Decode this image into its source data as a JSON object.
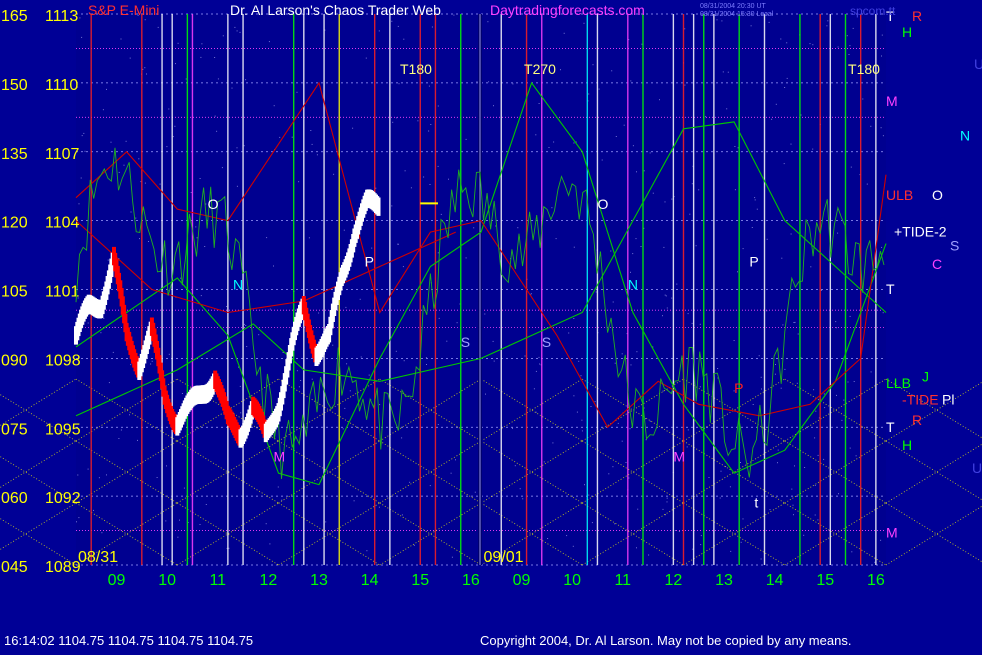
{
  "header": {
    "symbol": "S&P E-Mini",
    "site_title": "Dr. Al Larson's Chaos Trader Web",
    "site_url": "Daytradingforecasts.com",
    "stamp_line1": "08/31/2004 20:30 UT",
    "stamp_line2": "08/31/2004 15:30 Local",
    "brand": "spcom.tt"
  },
  "footer": {
    "quote": "16:14:02  1104.75 1104.75 1104.75 1104.75",
    "copyright": "Copyright 2004, Dr. Al Larson. May not be copied by any means."
  },
  "chart_data": {
    "type": "line",
    "price_ticks": [
      "1113",
      "1110",
      "1107",
      "1104",
      "1101",
      "1098",
      "1095",
      "1092",
      "1089"
    ],
    "angle_ticks": [
      "165",
      "150",
      "135",
      "120",
      "105",
      "090",
      "075",
      "060",
      "045"
    ],
    "ylim": [
      1089,
      1113
    ],
    "x_hours": [
      "09",
      "10",
      "11",
      "12",
      "13",
      "14",
      "15",
      "16",
      "09",
      "10",
      "11",
      "12",
      "13",
      "14",
      "15",
      "16"
    ],
    "dates": [
      "08/31",
      "09/01"
    ],
    "time_markers": [
      "T180",
      "T270",
      "T180"
    ],
    "tide_labels": [
      "+TIDE-2",
      "-TIDE"
    ],
    "chart_labels": [
      "O",
      "P",
      "N",
      "S",
      "M",
      "O",
      "N",
      "P",
      "S",
      "M",
      "t",
      "P",
      "ULB",
      "LLB"
    ],
    "right_letters": [
      "T",
      "H",
      "M",
      "T",
      "T",
      "H",
      "M",
      "R",
      "U",
      "N",
      "O",
      "S",
      "C",
      "J",
      "Pl",
      "R",
      "U"
    ],
    "colors": {
      "background": "#000096",
      "up_bar": "#ffffff",
      "down_bar": "#ff0000",
      "flux_green": "#00c800",
      "flux_red": "#d00000",
      "grid_yellow": "#ffff00"
    },
    "series": [
      {
        "name": "S&P E-Mini",
        "x": [
          0.0,
          0.25,
          0.5,
          0.75,
          1.0,
          1.25,
          1.5,
          1.75,
          2.0,
          2.25,
          2.5,
          2.75,
          3.0,
          3.25,
          3.5,
          3.75,
          4.0,
          4.25,
          4.5,
          4.75,
          5.0,
          5.25,
          5.5,
          5.75,
          6.0,
          6.25,
          6.5,
          6.75,
          7.0,
          7.15
        ],
        "y": [
          1099.0,
          1100.1,
          1100.5,
          1102.3,
          1099.0,
          1097.8,
          1099.1,
          1096.4,
          1095.3,
          1095.8,
          1096.6,
          1097.2,
          1095.2,
          1094.8,
          1095.9,
          1094.5,
          1096.0,
          1098.3,
          1100.2,
          1098.4,
          1098.8,
          1101.6,
          1103.5,
          1104.6,
          1104.75,
          1104.75,
          1104.75,
          1104.75,
          1104.75,
          1104.75
        ]
      }
    ]
  }
}
